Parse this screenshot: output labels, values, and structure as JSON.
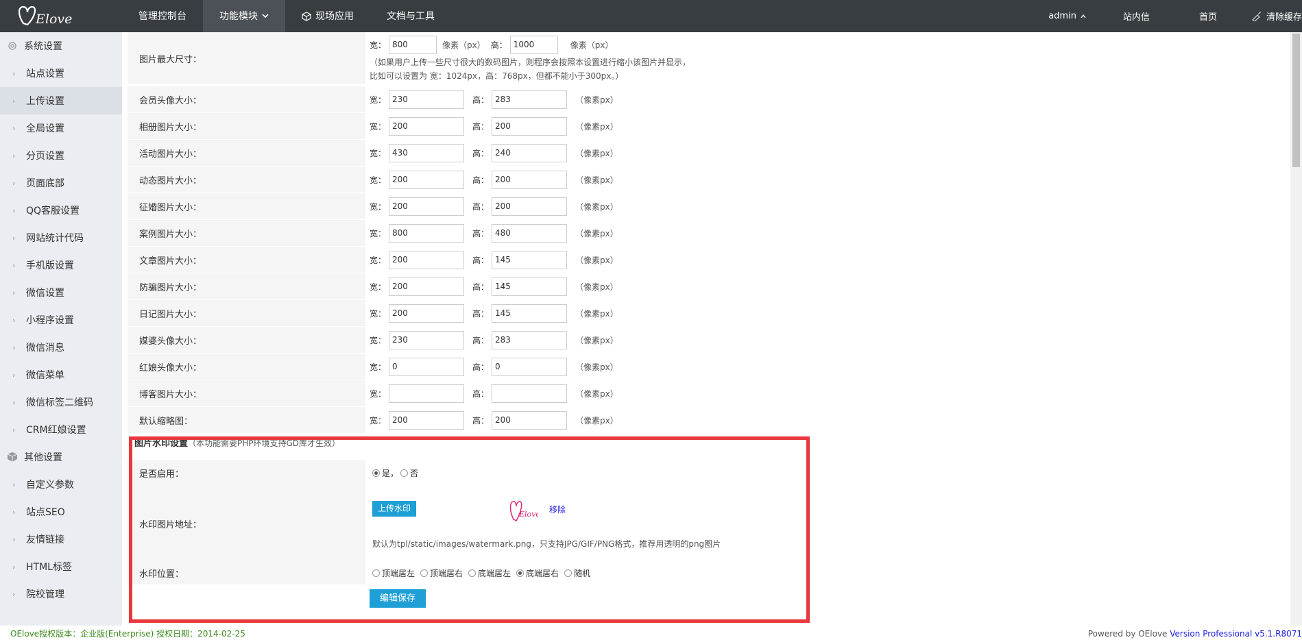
{
  "brand": {
    "logo_text": "OElove"
  },
  "nav": {
    "items": [
      "管理控制台",
      "功能模块",
      "现场应用",
      "文档与工具"
    ]
  },
  "topright": {
    "user": "admin",
    "messages": "站内信",
    "home": "首页",
    "clear_cache": "清除缓存"
  },
  "sidebar": {
    "group1": "系统设置",
    "items1": [
      "站点设置",
      "上传设置",
      "全局设置",
      "分页设置",
      "页面底部",
      "QQ客服设置",
      "网站统计代码",
      "手机版设置",
      "微信设置",
      "小程序设置",
      "微信消息",
      "微信菜单",
      "微信标签二维码",
      "CRM红娘设置"
    ],
    "group2": "其他设置",
    "items2": [
      "自定义参数",
      "站点SEO",
      "友情链接",
      "HTML标签",
      "院校管理"
    ]
  },
  "maxsize": {
    "label": "图片最大尺寸：",
    "w_label": "宽：",
    "w": "800",
    "unit": "像素（px）",
    "h_label": "高：",
    "h": "1000",
    "note1": "（如果用户上传一些尺寸很大的数码图片，则程序会按照本设置进行缩小该图片并显示，",
    "note2": "比如可以设置为 宽：1024px，高：768px，但都不能小于300px。）"
  },
  "size_rows": [
    {
      "label": "会员头像大小：",
      "w": "230",
      "h": "283"
    },
    {
      "label": "相册图片大小：",
      "w": "200",
      "h": "200"
    },
    {
      "label": "活动图片大小：",
      "w": "430",
      "h": "240"
    },
    {
      "label": "动态图片大小：",
      "w": "200",
      "h": "200"
    },
    {
      "label": "征婚图片大小：",
      "w": "200",
      "h": "200"
    },
    {
      "label": "案例图片大小：",
      "w": "800",
      "h": "480"
    },
    {
      "label": "文章图片大小：",
      "w": "200",
      "h": "145"
    },
    {
      "label": "防骗图片大小：",
      "w": "200",
      "h": "145"
    },
    {
      "label": "日记图片大小：",
      "w": "200",
      "h": "145"
    },
    {
      "label": "媒婆头像大小：",
      "w": "230",
      "h": "283"
    },
    {
      "label": "红娘头像大小：",
      "w": "0",
      "h": "0"
    },
    {
      "label": "博客图片大小：",
      "w": "",
      "h": ""
    },
    {
      "label": "默认缩略图：",
      "w": "200",
      "h": "200"
    }
  ],
  "row_labels": {
    "w": "宽：",
    "h": "高：",
    "unit": "（像素px）"
  },
  "watermark": {
    "title": "图片水印设置",
    "title_note": "（本功能需要PHP环境支持GD库才生效）",
    "enable_label": "是否启用：",
    "yes": "是，",
    "no": "否",
    "addr_label": "水印图片地址：",
    "upload_btn": "上传水印",
    "remove": "移除",
    "addr_note": "默认为tpl/static/images/watermark.png，只支持JPG/GIF/PNG格式，推荐用透明的png图片",
    "pos_label": "水印位置：",
    "positions": [
      "顶端居左",
      "顶端居右",
      "底端居左",
      "底端居右",
      "随机"
    ],
    "save": "编辑保存"
  },
  "footer": {
    "left": "OElove授权版本：企业版(Enterprise) 授权日期：2014-02-25",
    "right_prefix": "Powered by OElove ",
    "right_version": "Version Professional v5.1.R8071"
  },
  "colors": {
    "topbar": "#373d41",
    "accent": "#1e9fd6",
    "highlight": "#e8383d",
    "footer_left": "#3a8a1a",
    "footer_link": "#1a1adf"
  }
}
